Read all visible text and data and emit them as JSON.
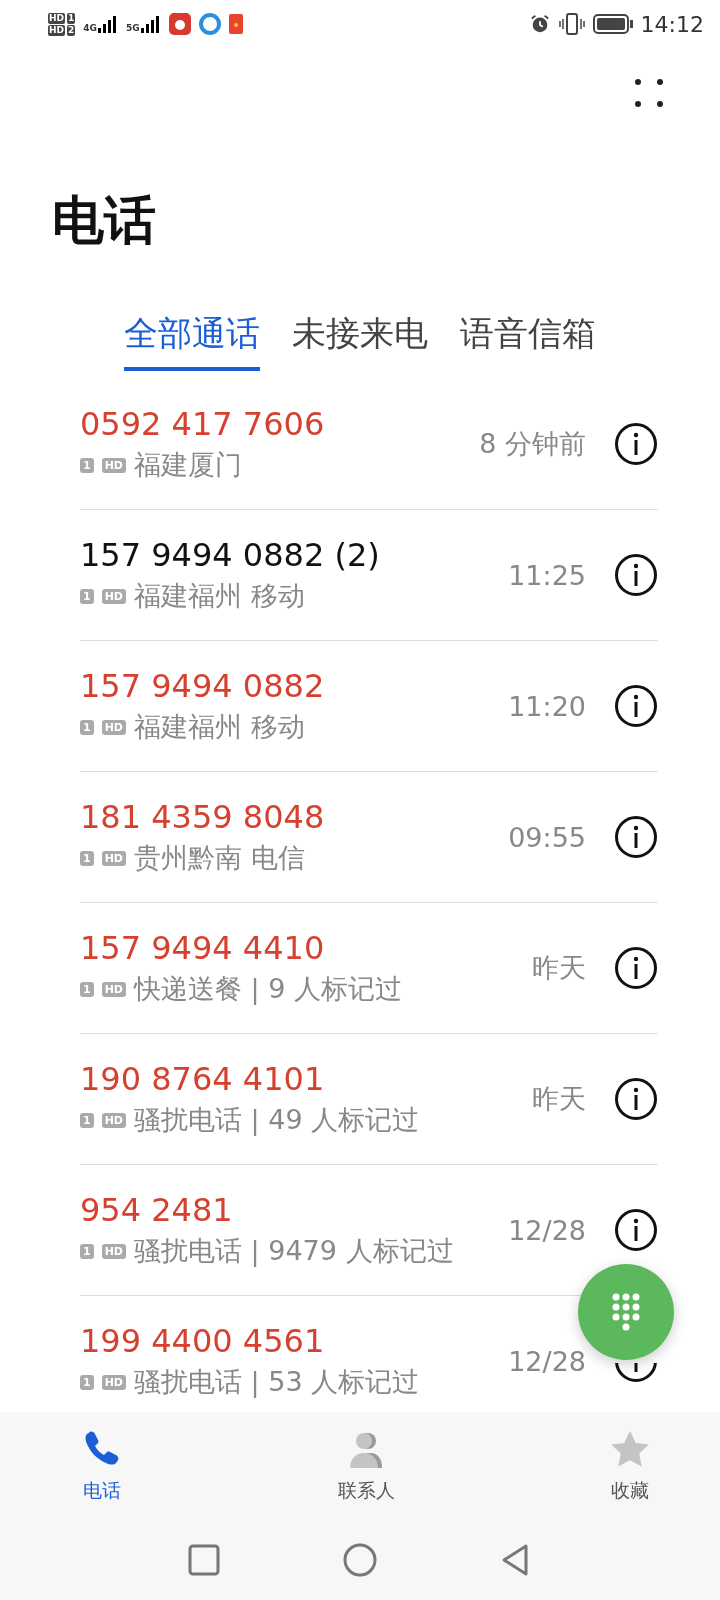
{
  "status_bar": {
    "sim_labels": [
      "HD",
      "1",
      "HD",
      "2"
    ],
    "networks": [
      "4G",
      "5G"
    ],
    "time": "14:12"
  },
  "title": "电话",
  "tabs": [
    {
      "label": "全部通话",
      "selected": true
    },
    {
      "label": "未接来电",
      "selected": false
    },
    {
      "label": "语音信箱",
      "selected": false
    }
  ],
  "calls": [
    {
      "number": "0592 417 7606",
      "missed": true,
      "sim": "1",
      "hd": "HD",
      "location": "福建厦门",
      "time": "8 分钟前"
    },
    {
      "number": "157 9494 0882 (2)",
      "missed": false,
      "sim": "1",
      "hd": "HD",
      "location": "福建福州 移动",
      "time": "11:25"
    },
    {
      "number": "157 9494 0882",
      "missed": true,
      "sim": "1",
      "hd": "HD",
      "location": "福建福州 移动",
      "time": "11:20"
    },
    {
      "number": "181 4359 8048",
      "missed": true,
      "sim": "1",
      "hd": "HD",
      "location": "贵州黔南 电信",
      "time": "09:55"
    },
    {
      "number": "157 9494 4410",
      "missed": true,
      "sim": "1",
      "hd": "HD",
      "location": "快递送餐 | 9 人标记过",
      "time": "昨天"
    },
    {
      "number": "190 8764 4101",
      "missed": true,
      "sim": "1",
      "hd": "HD",
      "location": "骚扰电话 | 49 人标记过",
      "time": "昨天"
    },
    {
      "number": "954 2481",
      "missed": true,
      "sim": "1",
      "hd": "HD",
      "location": "骚扰电话 | 9479 人标记过",
      "time": "12/28"
    },
    {
      "number": "199 4400 4561",
      "missed": true,
      "sim": "1",
      "hd": "HD",
      "location": "骚扰电话 | 53 人标记过",
      "time": "12/28"
    }
  ],
  "bottom_nav": [
    {
      "kind": "phone",
      "label": "电话",
      "selected": true
    },
    {
      "kind": "contacts",
      "label": "联系人",
      "selected": false
    },
    {
      "kind": "favorites",
      "label": "收藏",
      "selected": false
    }
  ]
}
